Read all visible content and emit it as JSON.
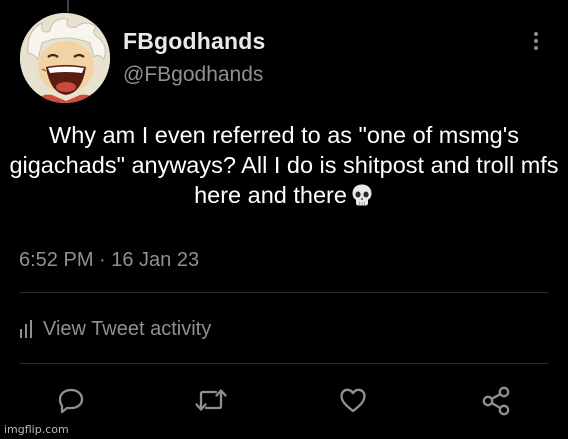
{
  "tweet": {
    "display_name": "FBgodhands",
    "handle": "@FBgodhands",
    "text": "Why am I even referred to as \"one of msmg's gigachads\" anyways? All I do is shitpost and troll mfs here and there",
    "emoji": "skull",
    "timestamp": "6:52 PM · 16 Jan 23",
    "activity_label": "View Tweet activity"
  },
  "actions": {
    "icons": [
      "reply-icon",
      "retweet-icon",
      "like-icon",
      "share-icon"
    ]
  },
  "watermark": "imgflip.com",
  "colors": {
    "background": "#000000",
    "text": "#ffffff",
    "secondary": "#8b9196"
  }
}
